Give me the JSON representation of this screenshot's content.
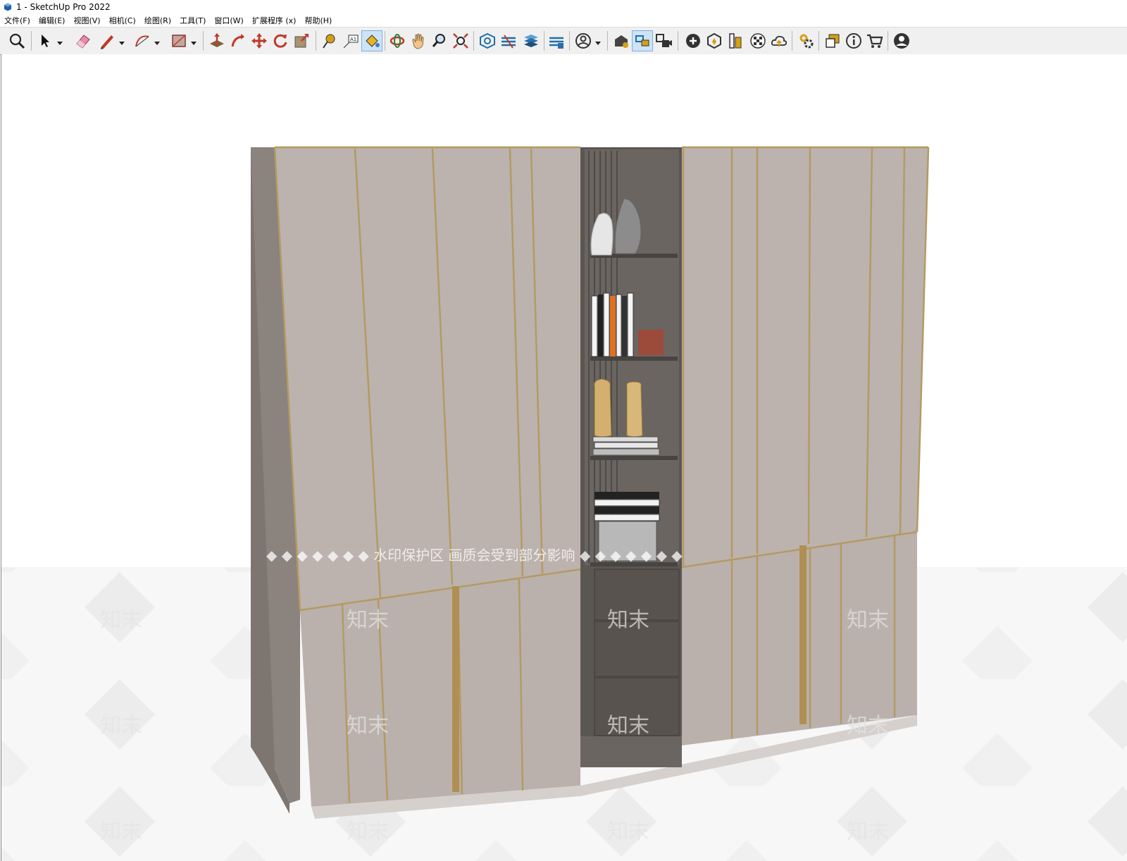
{
  "window": {
    "title": "1 - SketchUp Pro 2022"
  },
  "menu": [
    "文件(F)",
    "编辑(E)",
    "视图(V)",
    "相机(C)",
    "绘图(R)",
    "工具(T)",
    "窗口(W)",
    "扩展程序 (x)",
    "帮助(H)"
  ],
  "toolbar": {
    "icons": [
      "zoom-window-icon",
      "select-arrow-icon",
      "eraser-icon",
      "pencil-line-icon",
      "arc-icon",
      "rectangle-icon",
      "push-pull-icon",
      "follow-me-icon",
      "move-icon",
      "rotate-icon",
      "scale-icon",
      "tape-measure-icon",
      "text-label-icon",
      "paint-bucket-icon",
      "orbit-icon",
      "pan-hand-icon",
      "zoom-icon",
      "zoom-extents-icon",
      "section-plane-icon",
      "section-display-icon",
      "section-cut-icon",
      "section-fill-icon",
      "user-account-icon",
      "warehouse-icon",
      "components-icon",
      "scenes-icon",
      "add-location-icon",
      "sandbox-icon",
      "extension-manager-icon",
      "checkerboard-icon",
      "cloud-upload-icon",
      "preferences-gear-icon",
      "outliner-icon",
      "entity-info-icon",
      "shopping-cart-icon",
      "profile-icon"
    ]
  },
  "watermark": {
    "banner": "◆ ◆ ◆ ◆ ◆ ◆ ◆ 水印保护区  画质会受到部分影响 ◆ ◆ ◆ ◆ ◆ ◆ ◆",
    "brand": "知末"
  },
  "colors": {
    "panel": "#bcb3ae",
    "panel_side": "#7d7670",
    "gold_trim": "#b49a62",
    "niche": "#5a5652",
    "shelf": "#474441"
  }
}
